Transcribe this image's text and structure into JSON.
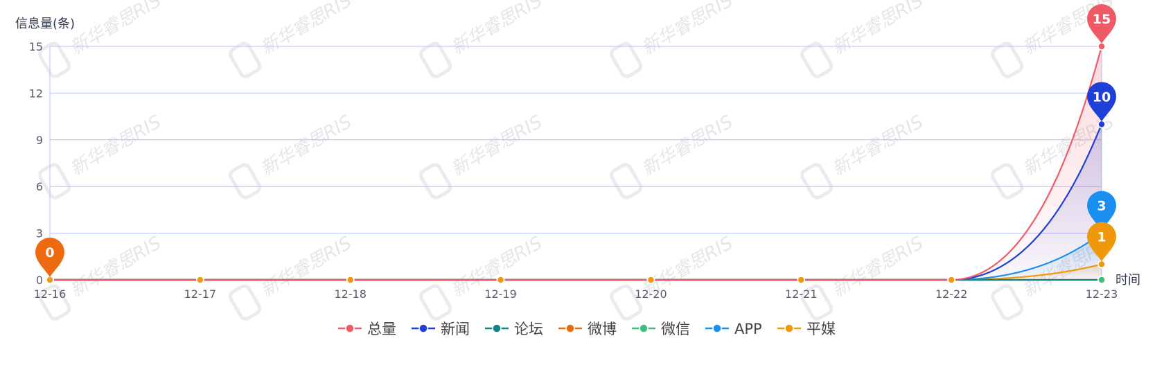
{
  "chart_data": {
    "type": "line",
    "xlabel": "时间",
    "ylabel": "信息量(条)",
    "x": [
      "12-16",
      "12-17",
      "12-18",
      "12-19",
      "12-20",
      "12-21",
      "12-22",
      "12-23"
    ],
    "ylim": [
      0,
      15
    ],
    "yticks": [
      "0",
      "3",
      "6",
      "9",
      "12",
      "15"
    ],
    "grid": true,
    "legend_position": "bottom-center",
    "series": [
      {
        "name": "总量",
        "color": "#f05a66",
        "values": [
          0,
          0,
          0,
          0,
          0,
          0,
          0,
          15
        ],
        "max_label": "15"
      },
      {
        "name": "新闻",
        "color": "#1f3fd8",
        "values": [
          0,
          0,
          0,
          0,
          0,
          0,
          0,
          10
        ],
        "max_label": "10"
      },
      {
        "name": "论坛",
        "color": "#138386",
        "values": [
          0,
          0,
          0,
          0,
          0,
          0,
          0,
          0
        ]
      },
      {
        "name": "微博",
        "color": "#ee6a10",
        "values": [
          0,
          0,
          0,
          0,
          0,
          0,
          0,
          0
        ],
        "min_label": "0"
      },
      {
        "name": "微信",
        "color": "#3bbf7a",
        "values": [
          0,
          0,
          0,
          0,
          0,
          0,
          0,
          0
        ]
      },
      {
        "name": "APP",
        "color": "#1a8ff0",
        "values": [
          0,
          0,
          0,
          0,
          0,
          0,
          0,
          3
        ],
        "max_label": "3"
      },
      {
        "name": "平媒",
        "color": "#f0980c",
        "values": [
          0,
          0,
          0,
          0,
          0,
          0,
          0,
          1
        ],
        "max_label": "1"
      }
    ]
  },
  "watermark": "新华睿思RIS"
}
